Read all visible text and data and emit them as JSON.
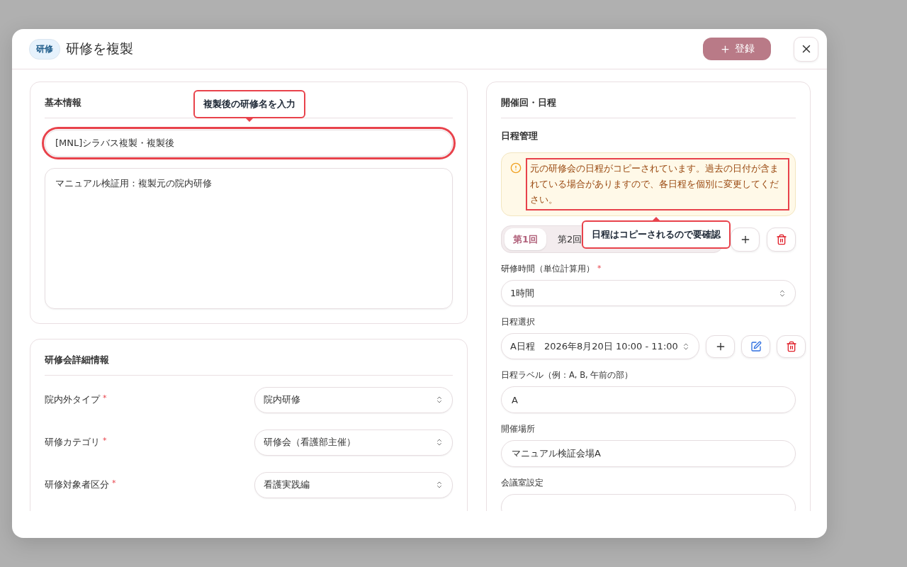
{
  "dialog": {
    "badge": "研修",
    "title": "研修を複製",
    "primary_button": "登録"
  },
  "basic_info": {
    "heading": "基本情報",
    "callout": "複製後の研修名を入力",
    "name_field": {
      "value": "[MNL]シラバス複製・複製後",
      "highlighted": true
    },
    "description_field": {
      "value": "マニュアル検証用：複製元の院内研修"
    }
  },
  "details": {
    "heading": "研修会詳細情報",
    "fields": [
      {
        "label": "院内外タイプ",
        "required_mark": "*",
        "value": "院内研修"
      },
      {
        "label": "研修カテゴリ",
        "required_mark": "*",
        "value": "研修会（看護部主催）"
      },
      {
        "label": "研修対象者区分",
        "required_mark": "*",
        "value": "看護実践編"
      }
    ]
  },
  "schedule": {
    "heading": "開催回・日程",
    "subheading": "日程管理",
    "warning": {
      "text": "元の研修会の日程がコピーされています。過去の日付が含まれている場合がありますので、各日程を個別に変更してください。",
      "highlighted": true
    },
    "callout": "日程はコピーされるので要確認",
    "sessions": [
      {
        "label": "第1回",
        "selected": true
      },
      {
        "label": "第2回",
        "selected": false
      }
    ],
    "fields": [
      {
        "kind": "select",
        "label": "研修時間（単位計算用）",
        "required_mark": "*",
        "value": "1時間"
      },
      {
        "kind": "schedule",
        "label": "日程選択",
        "value": "A日程　2026年8月20日 10:00 - 11:00"
      },
      {
        "kind": "input",
        "label": "日程ラベル（例：A, B, 午前の部）",
        "value": "A"
      },
      {
        "kind": "input",
        "label": "開催場所",
        "value": "マニュアル検証会場A"
      },
      {
        "kind": "input",
        "label": "会議室設定"
      }
    ]
  }
}
